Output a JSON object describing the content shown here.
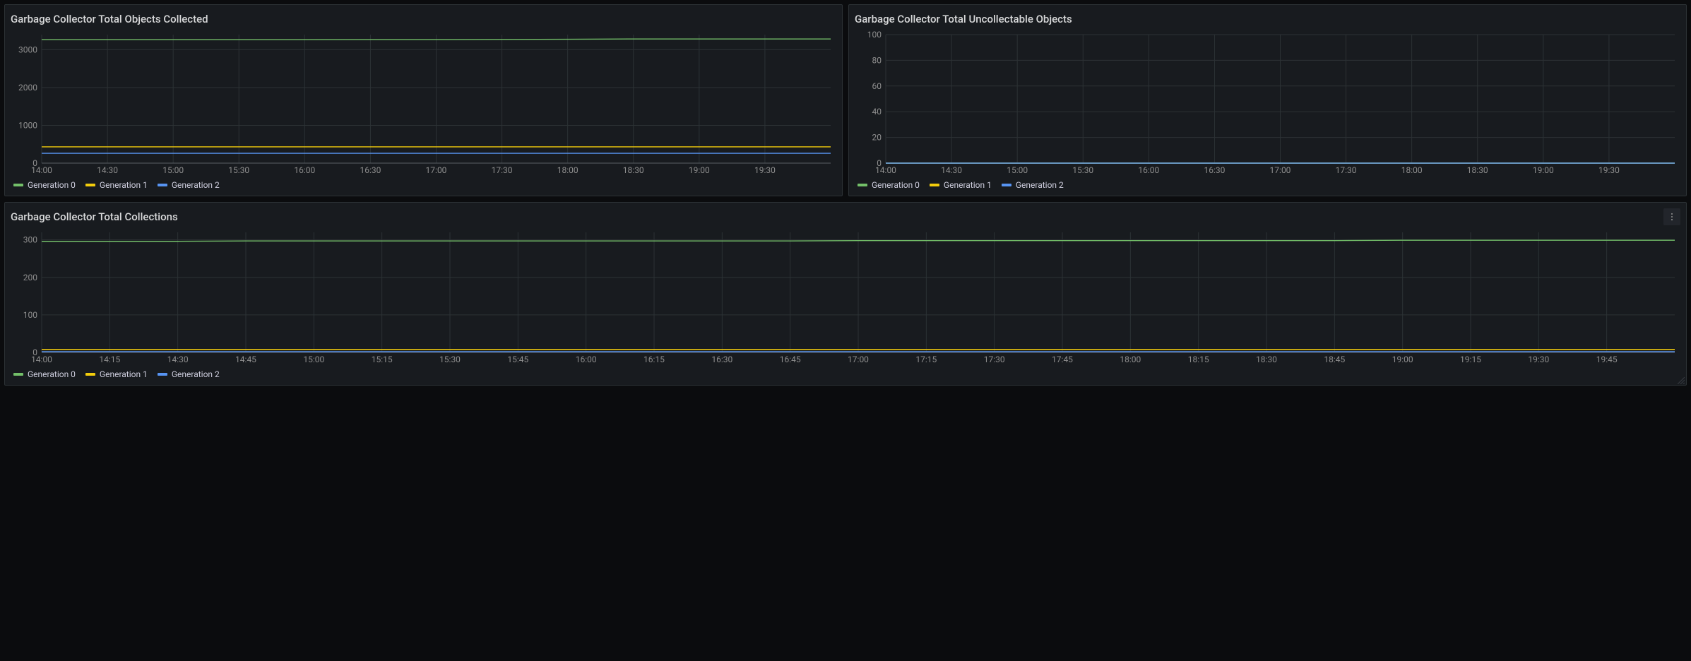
{
  "colors": {
    "gen0": "#73BF69",
    "gen1": "#F2CC0C",
    "gen2": "#5794F2"
  },
  "legend_labels": {
    "gen0": "Generation 0",
    "gen1": "Generation 1",
    "gen2": "Generation 2"
  },
  "panels": {
    "collected": {
      "title": "Garbage Collector Total Objects Collected"
    },
    "uncollectable": {
      "title": "Garbage Collector Total Uncollectable Objects"
    },
    "collections": {
      "title": "Garbage Collector Total Collections"
    }
  },
  "chart_data": [
    {
      "id": "collected",
      "type": "line",
      "title": "Garbage Collector Total Objects Collected",
      "xlabel": "",
      "ylabel": "",
      "y_ticks": [
        0,
        1000,
        2000,
        3000
      ],
      "ylim": [
        0,
        3400
      ],
      "x_ticks": [
        "14:00",
        "14:30",
        "15:00",
        "15:30",
        "16:00",
        "16:30",
        "17:00",
        "17:30",
        "18:00",
        "18:30",
        "19:00",
        "19:30"
      ],
      "x": [
        "14:00",
        "14:30",
        "15:00",
        "15:30",
        "16:00",
        "16:30",
        "17:00",
        "17:30",
        "18:00",
        "18:30",
        "19:00",
        "19:30",
        "19:58"
      ],
      "series": [
        {
          "name": "Generation 0",
          "color": "gen0",
          "values": [
            3265,
            3265,
            3265,
            3265,
            3265,
            3268,
            3268,
            3272,
            3278,
            3285,
            3285,
            3285,
            3285
          ]
        },
        {
          "name": "Generation 1",
          "color": "gen1",
          "values": [
            430,
            430,
            430,
            430,
            430,
            430,
            430,
            430,
            430,
            430,
            430,
            430,
            430
          ]
        },
        {
          "name": "Generation 2",
          "color": "gen2",
          "values": [
            260,
            260,
            260,
            260,
            260,
            260,
            260,
            260,
            260,
            260,
            260,
            260,
            260
          ]
        }
      ]
    },
    {
      "id": "uncollectable",
      "type": "line",
      "title": "Garbage Collector Total Uncollectable Objects",
      "xlabel": "",
      "ylabel": "",
      "y_ticks": [
        0,
        20,
        40,
        60,
        80,
        100
      ],
      "ylim": [
        0,
        100
      ],
      "x_ticks": [
        "14:00",
        "14:30",
        "15:00",
        "15:30",
        "16:00",
        "16:30",
        "17:00",
        "17:30",
        "18:00",
        "18:30",
        "19:00",
        "19:30"
      ],
      "x": [
        "14:00",
        "14:30",
        "15:00",
        "15:30",
        "16:00",
        "16:30",
        "17:00",
        "17:30",
        "18:00",
        "18:30",
        "19:00",
        "19:30",
        "19:58"
      ],
      "series": [
        {
          "name": "Generation 0",
          "color": "gen0",
          "values": [
            0,
            0,
            0,
            0,
            0,
            0,
            0,
            0,
            0,
            0,
            0,
            0,
            0
          ]
        },
        {
          "name": "Generation 1",
          "color": "gen1",
          "values": [
            0,
            0,
            0,
            0,
            0,
            0,
            0,
            0,
            0,
            0,
            0,
            0,
            0
          ]
        },
        {
          "name": "Generation 2",
          "color": "gen2",
          "values": [
            0,
            0,
            0,
            0,
            0,
            0,
            0,
            0,
            0,
            0,
            0,
            0,
            0
          ]
        }
      ]
    },
    {
      "id": "collections",
      "type": "line",
      "title": "Garbage Collector Total Collections",
      "xlabel": "",
      "ylabel": "",
      "y_ticks": [
        0,
        100,
        200,
        300
      ],
      "ylim": [
        0,
        320
      ],
      "x_ticks": [
        "14:00",
        "14:15",
        "14:30",
        "14:45",
        "15:00",
        "15:15",
        "15:30",
        "15:45",
        "16:00",
        "16:15",
        "16:30",
        "16:45",
        "17:00",
        "17:15",
        "17:30",
        "17:45",
        "18:00",
        "18:15",
        "18:30",
        "18:45",
        "19:00",
        "19:15",
        "19:30",
        "19:45"
      ],
      "x": [
        "14:00",
        "14:15",
        "14:30",
        "14:45",
        "15:00",
        "15:15",
        "15:30",
        "15:45",
        "16:00",
        "16:15",
        "16:30",
        "16:45",
        "17:00",
        "17:15",
        "17:30",
        "17:45",
        "18:00",
        "18:15",
        "18:30",
        "18:45",
        "19:00",
        "19:15",
        "19:30",
        "19:45",
        "19:58"
      ],
      "series": [
        {
          "name": "Generation 0",
          "color": "gen0",
          "values": [
            296,
            296,
            296,
            297,
            297,
            297,
            297,
            297,
            297,
            297,
            297,
            297,
            298,
            298,
            298,
            298,
            298,
            298,
            298,
            298,
            299,
            299,
            299,
            299,
            299
          ]
        },
        {
          "name": "Generation 1",
          "color": "gen1",
          "values": [
            8,
            8,
            8,
            8,
            8,
            8,
            8,
            8,
            8,
            8,
            8,
            8,
            8,
            8,
            8,
            8,
            8,
            8,
            8,
            8,
            8,
            8,
            8,
            8,
            8
          ]
        },
        {
          "name": "Generation 2",
          "color": "gen2",
          "values": [
            2,
            2,
            2,
            2,
            2,
            2,
            2,
            2,
            2,
            2,
            2,
            2,
            2,
            2,
            2,
            2,
            2,
            2,
            2,
            2,
            2,
            2,
            2,
            2,
            2
          ]
        }
      ]
    }
  ]
}
